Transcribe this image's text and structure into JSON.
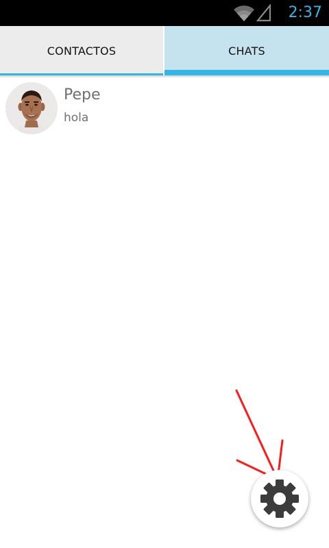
{
  "status_bar": {
    "time": "2:37",
    "time_color": "#33b5e5",
    "icons": [
      "wifi-icon",
      "signal-icon"
    ]
  },
  "tabs": [
    {
      "label": "CONTACTOS",
      "active": false
    },
    {
      "label": "CHATS",
      "active": true
    }
  ],
  "colors": {
    "accent": "#33b5e5",
    "active_tab_bg": "#c5e3ee",
    "inactive_tab_bg": "#ececec",
    "annotation": "#ff1a1a"
  },
  "chats": [
    {
      "name": "Pepe",
      "last_message": "hola",
      "avatar": "avatar-photo"
    }
  ],
  "fab": {
    "icon": "gear-icon"
  },
  "annotation": {
    "type": "red-arrow",
    "target": "settings-fab"
  }
}
